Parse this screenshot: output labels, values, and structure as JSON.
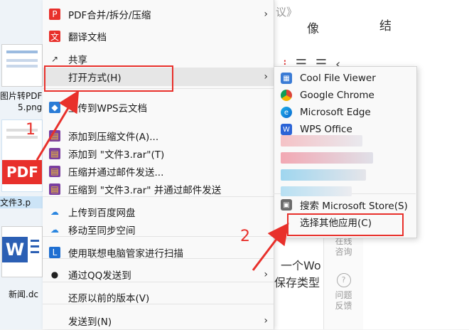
{
  "desktop": {
    "files": [
      {
        "caption": "图片转PDF",
        "caption2": "5.png"
      },
      {
        "caption": "文件3.p"
      },
      {
        "caption": "新闻.dc"
      }
    ],
    "pdf_label": "PDF",
    "word_label": "W"
  },
  "document": {
    "top_text_a": "议》",
    "top_text_b": "像",
    "top_text_c": "结",
    "mid_text": "一个Wo",
    "mid_text2": "保存类型",
    "side": {
      "online": "在线\n咨询",
      "feedback": "问题\n反馈"
    }
  },
  "menu": {
    "items": [
      {
        "label": "PDF合并/拆分/压缩",
        "icon": "pdf-icon",
        "arrow": true
      },
      {
        "label": "翻译文档",
        "icon": "translate-icon"
      },
      {
        "label": "共享",
        "icon": "share-icon"
      },
      {
        "label": "打开方式(H)",
        "icon": "",
        "arrow": true
      },
      {
        "label": "上传到WPS云文档",
        "icon": "wps-cloud-icon"
      },
      {
        "label": "添加到压缩文件(A)...",
        "icon": "winrar-icon"
      },
      {
        "label": "添加到 \"文件3.rar\"(T)",
        "icon": "winrar-icon"
      },
      {
        "label": "压缩并通过邮件发送...",
        "icon": "winrar-icon"
      },
      {
        "label": "压缩到 \"文件3.rar\" 并通过邮件发送",
        "icon": "winrar-icon"
      },
      {
        "label": "上传到百度网盘",
        "icon": "baidu-icon"
      },
      {
        "label": "移动至同步空间",
        "icon": "sync-icon"
      },
      {
        "label": "使用联想电脑管家进行扫描",
        "icon": "lenovo-icon"
      },
      {
        "label": "通过QQ发送到",
        "icon": "qq-icon",
        "arrow": true
      },
      {
        "label": "还原以前的版本(V)",
        "icon": ""
      },
      {
        "label": "发送到(N)",
        "icon": "",
        "arrow": true
      }
    ]
  },
  "submenu": {
    "items": [
      {
        "label": "Cool File Viewer",
        "icon": "cool-file-viewer-icon"
      },
      {
        "label": "Google Chrome",
        "icon": "chrome-icon"
      },
      {
        "label": "Microsoft Edge",
        "icon": "edge-icon"
      },
      {
        "label": "WPS Office",
        "icon": "wps-office-icon"
      },
      {
        "label": "搜索 Microsoft Store(S)",
        "icon": "store-icon"
      },
      {
        "label": "选择其他应用(C)",
        "icon": ""
      }
    ]
  },
  "annotations": {
    "step1": "1",
    "step2": "2"
  },
  "colors": {
    "annotation": "#e8302b",
    "highlight": "#e6e6e6"
  }
}
